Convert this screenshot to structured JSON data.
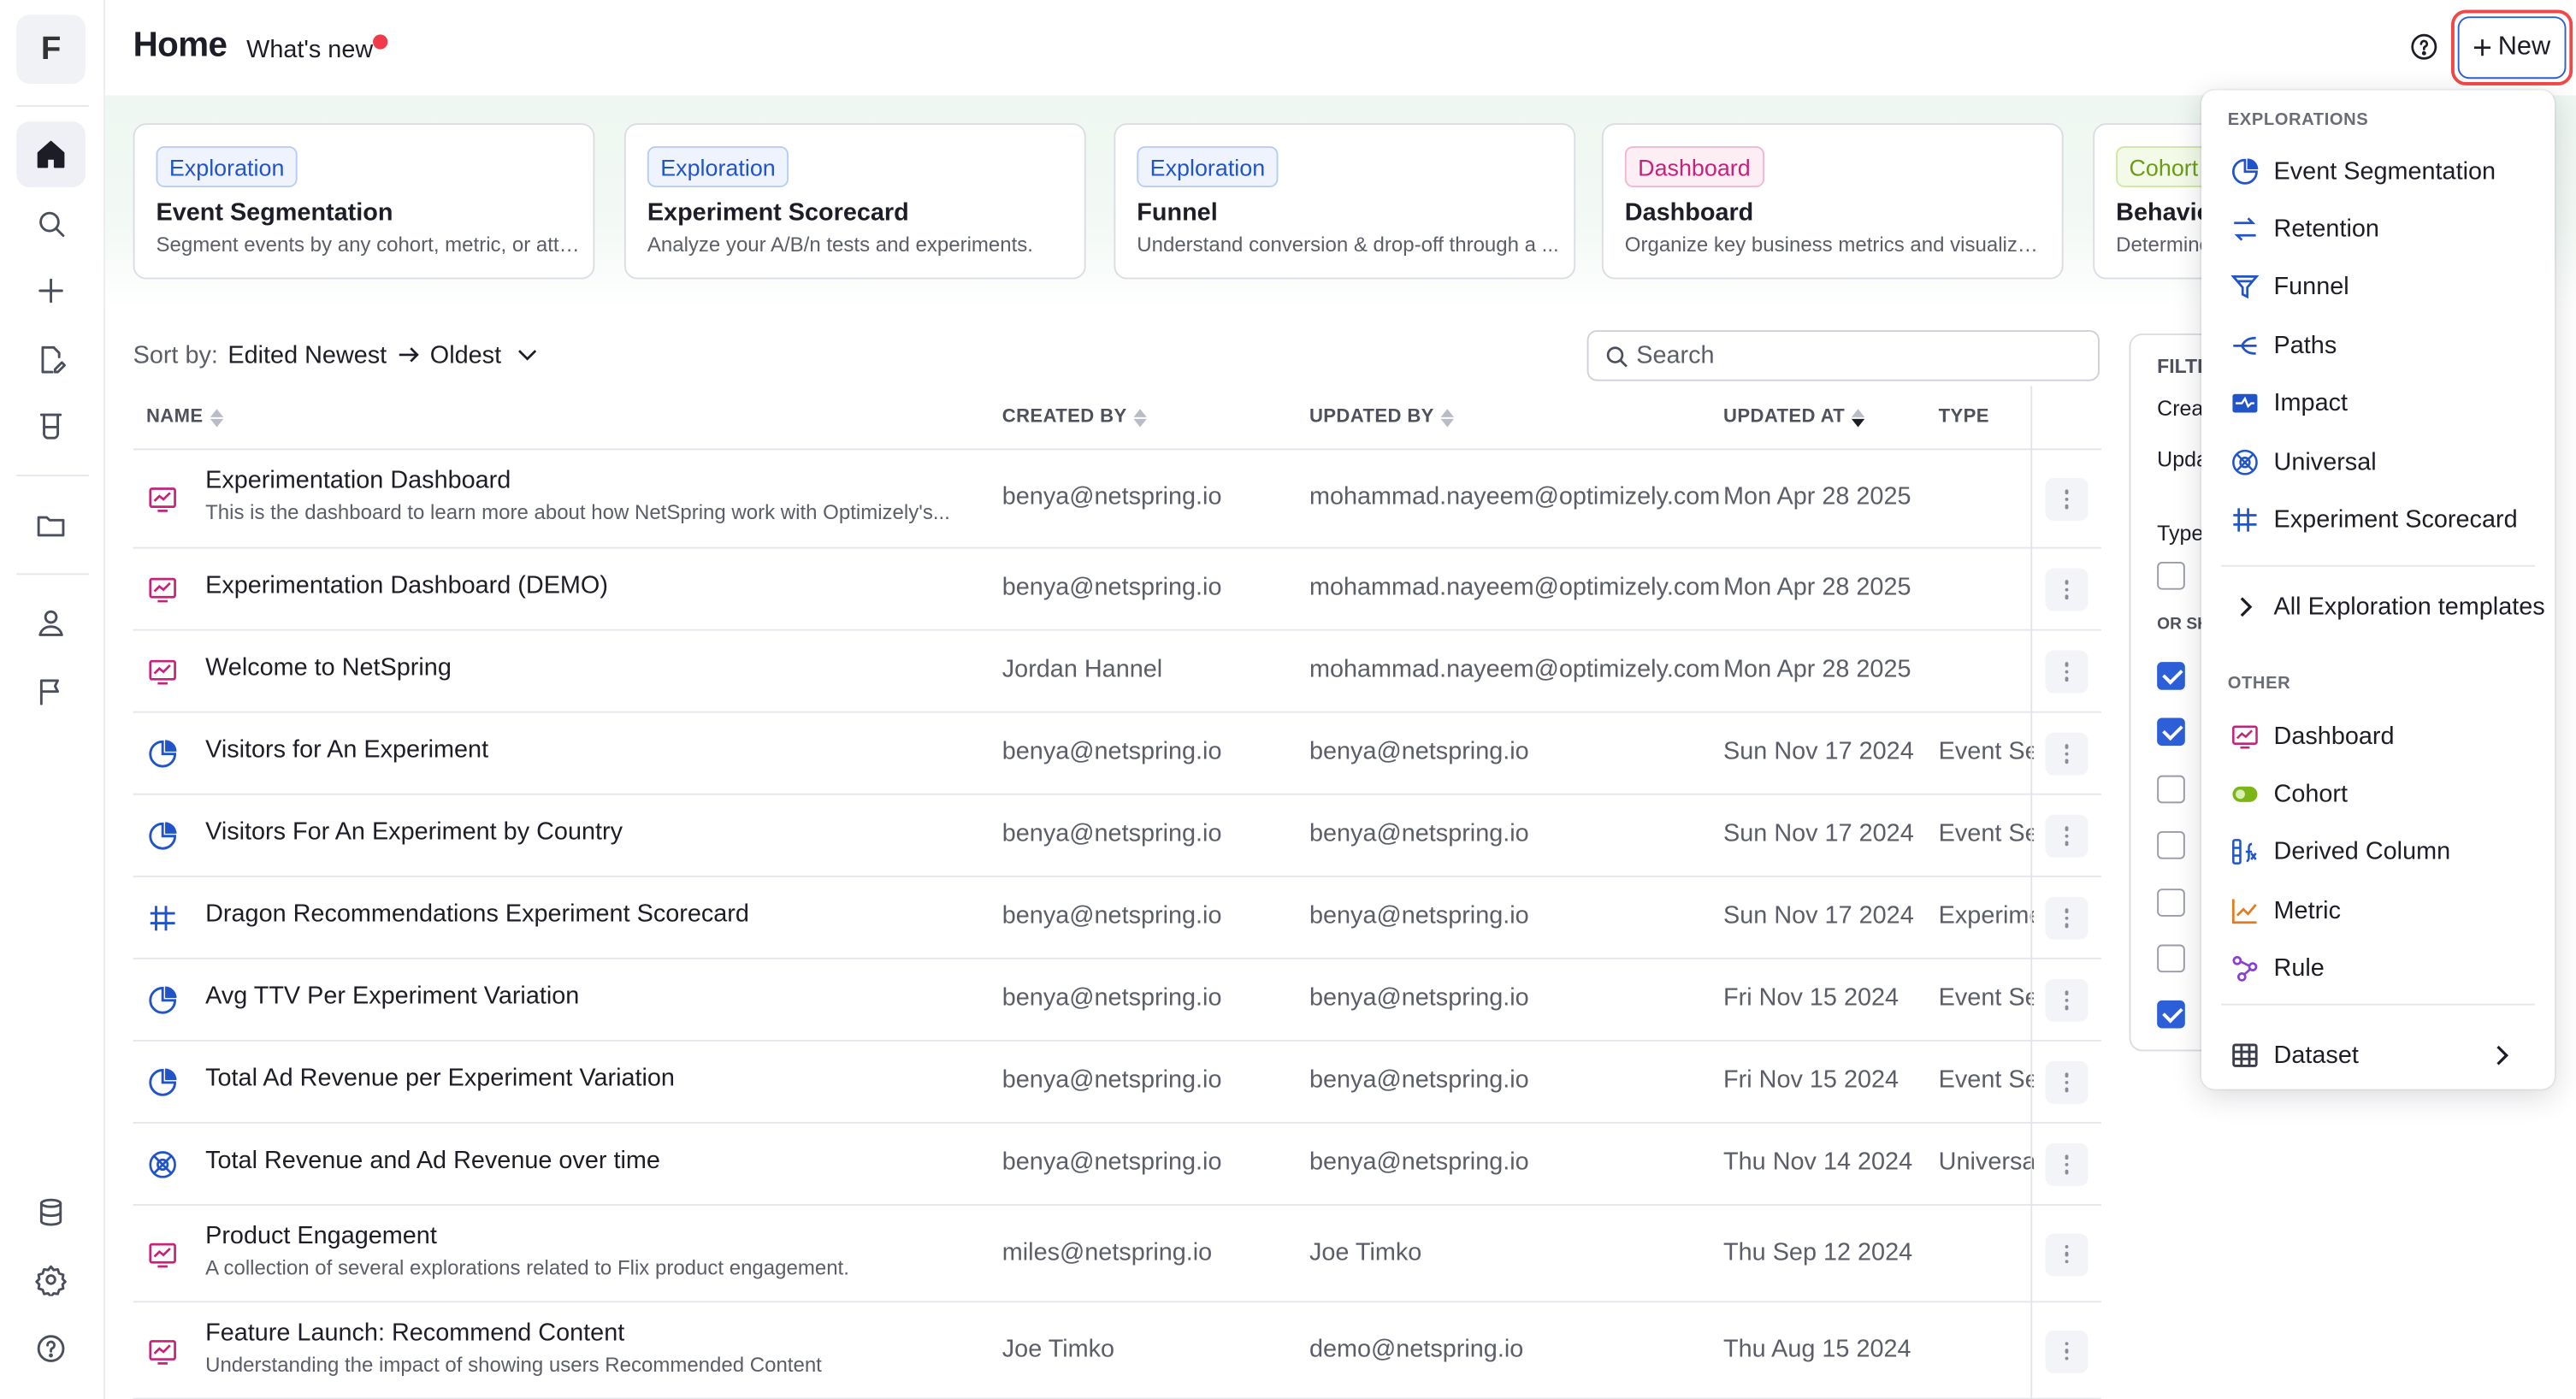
{
  "app": {
    "logo_letter": "F"
  },
  "header": {
    "title": "Home",
    "whats_new": "What's new",
    "new_button": "New"
  },
  "templates": [
    {
      "badge": "Exploration",
      "kind": "expl",
      "title": "Event Segmentation",
      "desc": "Segment events by any cohort, metric, or attri..."
    },
    {
      "badge": "Exploration",
      "kind": "expl",
      "title": "Experiment Scorecard",
      "desc": "Analyze your A/B/n tests and experiments."
    },
    {
      "badge": "Exploration",
      "kind": "expl",
      "title": "Funnel",
      "desc": "Understand conversion & drop-off through a ..."
    },
    {
      "badge": "Dashboard",
      "kind": "dash",
      "title": "Dashboard",
      "desc": "Organize key business metrics and visualizati..."
    },
    {
      "badge": "Cohort",
      "kind": "coh",
      "title": "Behavio",
      "desc": "Determine"
    }
  ],
  "sort": {
    "label": "Sort by:",
    "value_a": "Edited Newest",
    "value_b": "Oldest"
  },
  "search": {
    "placeholder": "Search"
  },
  "table": {
    "columns": {
      "name": "NAME",
      "created_by": "CREATED BY",
      "updated_by": "UPDATED BY",
      "updated_at": "UPDATED AT",
      "type": "TYPE"
    },
    "rows": [
      {
        "icon": "dashboard",
        "name": "Experimentation Dashboard",
        "desc": "This is the dashboard to learn more about how NetSpring work with Optimizely's...",
        "created_by": "benya@netspring.io",
        "updated_by": "mohammad.nayeem@optimizely.com",
        "updated_at": "Mon Apr 28 2025",
        "type": ""
      },
      {
        "icon": "dashboard",
        "name": "Experimentation Dashboard (DEMO)",
        "desc": "",
        "created_by": "benya@netspring.io",
        "updated_by": "mohammad.nayeem@optimizely.com",
        "updated_at": "Mon Apr 28 2025",
        "type": ""
      },
      {
        "icon": "dashboard",
        "name": "Welcome to NetSpring",
        "desc": "",
        "created_by": "Jordan Hannel",
        "updated_by": "mohammad.nayeem@optimizely.com",
        "updated_at": "Mon Apr 28 2025",
        "type": ""
      },
      {
        "icon": "segmentation",
        "name": "Visitors for An Experiment",
        "desc": "",
        "created_by": "benya@netspring.io",
        "updated_by": "benya@netspring.io",
        "updated_at": "Sun Nov 17 2024",
        "type": "Event Segmentation"
      },
      {
        "icon": "segmentation",
        "name": "Visitors For An Experiment by Country",
        "desc": "",
        "created_by": "benya@netspring.io",
        "updated_by": "benya@netspring.io",
        "updated_at": "Sun Nov 17 2024",
        "type": "Event Segmentation"
      },
      {
        "icon": "scorecard",
        "name": "Dragon Recommendations Experiment Scorecard",
        "desc": "",
        "created_by": "benya@netspring.io",
        "updated_by": "benya@netspring.io",
        "updated_at": "Sun Nov 17 2024",
        "type": "Experiment Scorecard"
      },
      {
        "icon": "segmentation",
        "name": "Avg TTV Per Experiment Variation",
        "desc": "",
        "created_by": "benya@netspring.io",
        "updated_by": "benya@netspring.io",
        "updated_at": "Fri Nov 15 2024",
        "type": "Event Segmentation"
      },
      {
        "icon": "segmentation",
        "name": "Total Ad Revenue per Experiment Variation",
        "desc": "",
        "created_by": "benya@netspring.io",
        "updated_by": "benya@netspring.io",
        "updated_at": "Fri Nov 15 2024",
        "type": "Event Segmentation"
      },
      {
        "icon": "universal",
        "name": "Total Revenue and Ad Revenue over time",
        "desc": "",
        "created_by": "benya@netspring.io",
        "updated_by": "benya@netspring.io",
        "updated_at": "Thu Nov 14 2024",
        "type": "Universal"
      },
      {
        "icon": "dashboard",
        "name": "Product Engagement",
        "desc": "A collection of several explorations related to Flix product engagement.",
        "created_by": "miles@netspring.io",
        "updated_by": "Joe Timko",
        "updated_at": "Thu Sep 12 2024",
        "type": ""
      },
      {
        "icon": "dashboard",
        "name": "Feature Launch: Recommend Content",
        "desc": "Understanding the impact of showing users Recommended Content",
        "created_by": "Joe Timko",
        "updated_by": "demo@netspring.io",
        "updated_at": "Thu Aug 15 2024",
        "type": ""
      }
    ]
  },
  "filters": {
    "title": "FILTE",
    "created": "Crea",
    "updated": "Upda",
    "type": "Type",
    "or_show": "OR SH",
    "checkboxes": [
      false,
      true,
      true,
      false,
      false,
      false,
      false,
      true
    ]
  },
  "menu": {
    "explorations_title": "EXPLORATIONS",
    "explorations": [
      {
        "icon": "segmentation",
        "label": "Event Segmentation"
      },
      {
        "icon": "retention",
        "label": "Retention"
      },
      {
        "icon": "funnel",
        "label": "Funnel"
      },
      {
        "icon": "paths",
        "label": "Paths"
      },
      {
        "icon": "impact",
        "label": "Impact"
      },
      {
        "icon": "universal",
        "label": "Universal"
      },
      {
        "icon": "scorecard",
        "label": "Experiment Scorecard"
      }
    ],
    "all_templates": "All Exploration templates",
    "other_title": "OTHER",
    "other": [
      {
        "icon": "dashboard",
        "label": "Dashboard"
      },
      {
        "icon": "cohort",
        "label": "Cohort"
      },
      {
        "icon": "derived-column",
        "label": "Derived Column"
      },
      {
        "icon": "metric",
        "label": "Metric"
      },
      {
        "icon": "rule",
        "label": "Rule"
      }
    ],
    "dataset": "Dataset"
  },
  "colors": {
    "accent": "#2d5fd8",
    "focus_ring": "#f04848",
    "dashboard_pink": "#c5227a",
    "cohort_green": "#7cb518",
    "metric_orange": "#e07b1f",
    "rule_purple": "#8a3fd1"
  }
}
